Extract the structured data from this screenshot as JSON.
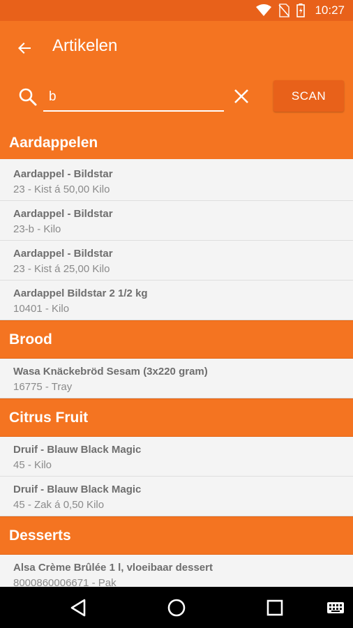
{
  "status_bar": {
    "time": "10:27",
    "icons": [
      "wifi-icon",
      "no-sim-icon",
      "battery-icon"
    ]
  },
  "app_bar": {
    "title": "Artikelen",
    "back_icon": "arrow-back-icon"
  },
  "search": {
    "value": "b",
    "icon": "search-icon",
    "clear_icon": "close-icon",
    "scan_label": "SCAN"
  },
  "groups": [
    {
      "name": "Aardappelen",
      "items": [
        {
          "name": "Aardappel - Bildstar",
          "sub": "23 - Kist  á  50,00 Kilo"
        },
        {
          "name": "Aardappel - Bildstar",
          "sub": "23-b - Kilo"
        },
        {
          "name": "Aardappel - Bildstar",
          "sub": "23 - Kist  á  25,00 Kilo"
        },
        {
          "name": "Aardappel Bildstar 2 1/2 kg",
          "sub": "10401 - Kilo"
        }
      ]
    },
    {
      "name": "Brood",
      "items": [
        {
          "name": "Wasa Knäckebröd Sesam (3x220 gram)",
          "sub": "16775 - Tray"
        }
      ]
    },
    {
      "name": "Citrus Fruit",
      "items": [
        {
          "name": "Druif - Blauw Black Magic",
          "sub": "45 - Kilo"
        },
        {
          "name": "Druif - Blauw Black Magic",
          "sub": "45 - Zak  á  0,50 Kilo"
        }
      ]
    },
    {
      "name": "Desserts",
      "items": [
        {
          "name": "Alsa Crème Brûlée 1 l, vloeibaar dessert",
          "sub": "8000860006671 - Pak"
        }
      ]
    }
  ],
  "nav_bar": {
    "buttons": [
      "back-triangle-icon",
      "home-circle-icon",
      "recents-square-icon",
      "keyboard-icon"
    ]
  },
  "colors": {
    "primary": "#f47421",
    "primary_dark": "#e8611a",
    "list_bg": "#f4f4f4",
    "text": "#6e6e6e"
  }
}
